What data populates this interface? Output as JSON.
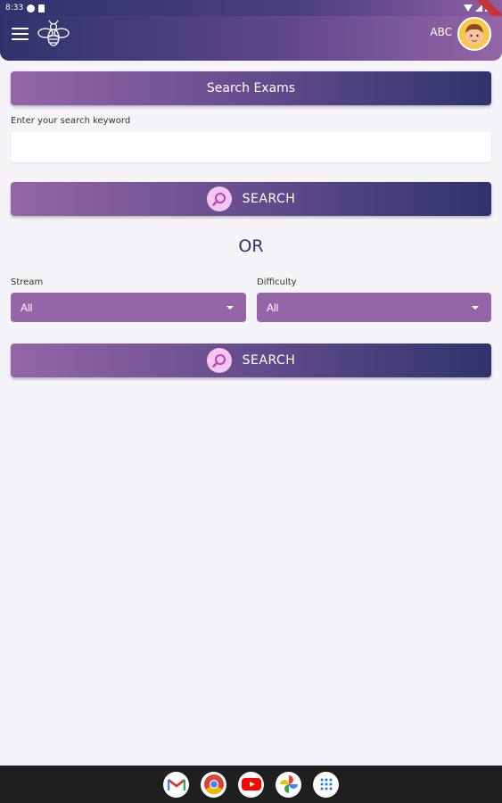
{
  "status_bar": {
    "time": "8:33"
  },
  "app_bar": {
    "user_label": "ABC"
  },
  "header": {
    "title": "Search Exams"
  },
  "keyword": {
    "label": "Enter your search keyword",
    "value": "",
    "placeholder": ""
  },
  "search_button_1": {
    "label": "SEARCH"
  },
  "separator": {
    "text": "OR"
  },
  "stream": {
    "label": "Stream",
    "selected": "All"
  },
  "difficulty": {
    "label": "Difficulty",
    "selected": "All"
  },
  "search_button_2": {
    "label": "SEARCH"
  },
  "colors": {
    "primary_dark": "#2f336b",
    "primary_light": "#9466a8",
    "search_icon_bg": "#f2c6ee",
    "background": "#f5f5f9"
  },
  "dock_apps": [
    "gmail-icon",
    "chrome-icon",
    "youtube-icon",
    "photos-icon",
    "app-drawer-icon"
  ]
}
